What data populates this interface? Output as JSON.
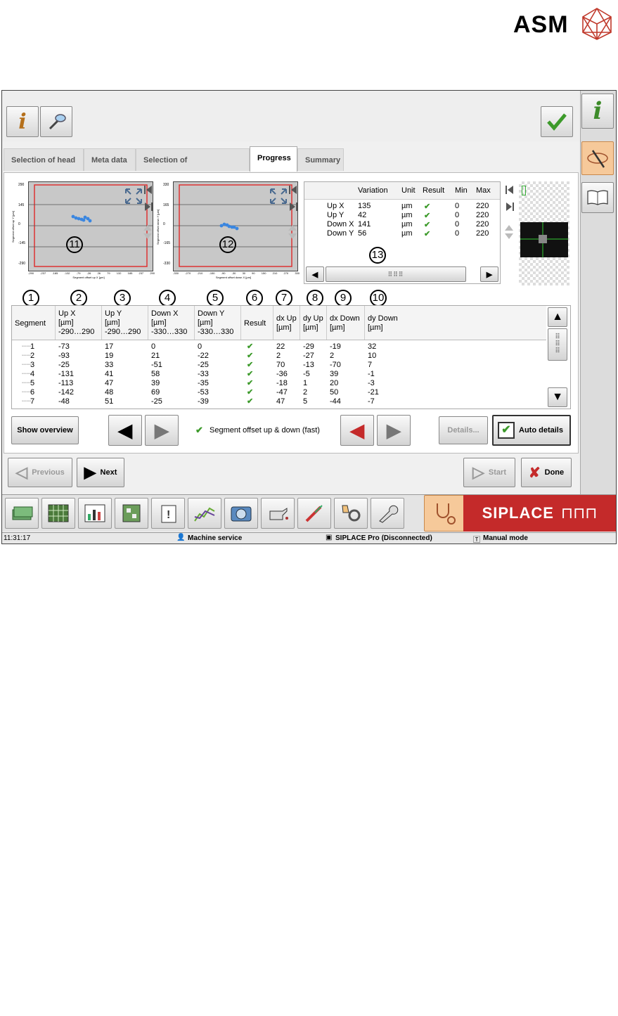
{
  "logo": {
    "text": "ASM"
  },
  "tabs": [
    "Selection of head",
    "Meta data",
    "Selection of measurements",
    "Progress",
    "Summary"
  ],
  "plot_markers": [
    "11",
    "12",
    "13"
  ],
  "plots": [
    {
      "yticks": [
        "290",
        "145",
        "0",
        "-145",
        "-290"
      ],
      "ylabel": "Segment offset up Y [µm]",
      "xlabel": "Segment offset up X [µm]",
      "xticks": [
        "-290",
        "-237",
        "-185",
        "-132",
        "-79",
        "-26",
        "26",
        "79",
        "132",
        "185",
        "237",
        "290"
      ]
    },
    {
      "yticks": [
        "330",
        "165",
        "0",
        "-165",
        "-330"
      ],
      "ylabel": "Segment offset down Y [µm]",
      "xlabel": "Segment offset down X [µm]",
      "xticks": [
        "-330",
        "-270",
        "-210",
        "-150",
        "-90",
        "-30",
        "30",
        "90",
        "150",
        "210",
        "270",
        "330"
      ]
    }
  ],
  "variation_table": {
    "headers": [
      "Variation",
      "Unit",
      "Result",
      "Min",
      "Max"
    ],
    "rows": [
      {
        "name": "Up X",
        "variation": "135",
        "unit": "µm",
        "min": "0",
        "max": "220"
      },
      {
        "name": "Up Y",
        "variation": "42",
        "unit": "µm",
        "min": "0",
        "max": "220"
      },
      {
        "name": "Down X",
        "variation": "141",
        "unit": "µm",
        "min": "0",
        "max": "220"
      },
      {
        "name": "Down Y",
        "variation": "56",
        "unit": "µm",
        "min": "0",
        "max": "220"
      }
    ]
  },
  "column_markers": [
    "1",
    "2",
    "3",
    "4",
    "5",
    "6",
    "7",
    "8",
    "9",
    "10"
  ],
  "grid": {
    "headers": [
      "Segment",
      "Up X\n[µm]\n-290…290",
      "Up Y\n[µm]\n-290…290",
      "Down X\n[µm]\n-330…330",
      "Down Y\n[µm]\n-330…330",
      "Result",
      "dx Up\n[µm]",
      "dy Up\n[µm]",
      "dx Down\n[µm]",
      "dy Down\n[µm]"
    ],
    "rows": [
      [
        "1",
        "-73",
        "17",
        "0",
        "0",
        "22",
        "-29",
        "-19",
        "32"
      ],
      [
        "2",
        "-93",
        "19",
        "21",
        "-22",
        "2",
        "-27",
        "2",
        "10"
      ],
      [
        "3",
        "-25",
        "33",
        "-51",
        "-25",
        "70",
        "-13",
        "-70",
        "7"
      ],
      [
        "4",
        "-131",
        "41",
        "58",
        "-33",
        "-36",
        "-5",
        "39",
        "-1"
      ],
      [
        "5",
        "-113",
        "47",
        "39",
        "-35",
        "-18",
        "1",
        "20",
        "-3"
      ],
      [
        "6",
        "-142",
        "48",
        "69",
        "-53",
        "-47",
        "2",
        "50",
        "-21"
      ],
      [
        "7",
        "-48",
        "51",
        "-25",
        "-39",
        "47",
        "5",
        "-44",
        "-7"
      ]
    ]
  },
  "controls": {
    "show_overview": "Show overview",
    "measurement_label": "Segment offset up & down (fast)",
    "details": "Details...",
    "auto_details": "Auto details",
    "previous": "Previous",
    "next": "Next",
    "start": "Start",
    "done": "Done"
  },
  "brand": "SIPLACE",
  "status": {
    "time": "11:31:17",
    "user": "Machine service",
    "connection": "SIPLACE Pro (Disconnected)",
    "mode": "Manual mode"
  },
  "colors": {
    "accent_red": "#c42a2a",
    "check_green": "#3c9a2a",
    "plot_point": "#3a86e0"
  }
}
